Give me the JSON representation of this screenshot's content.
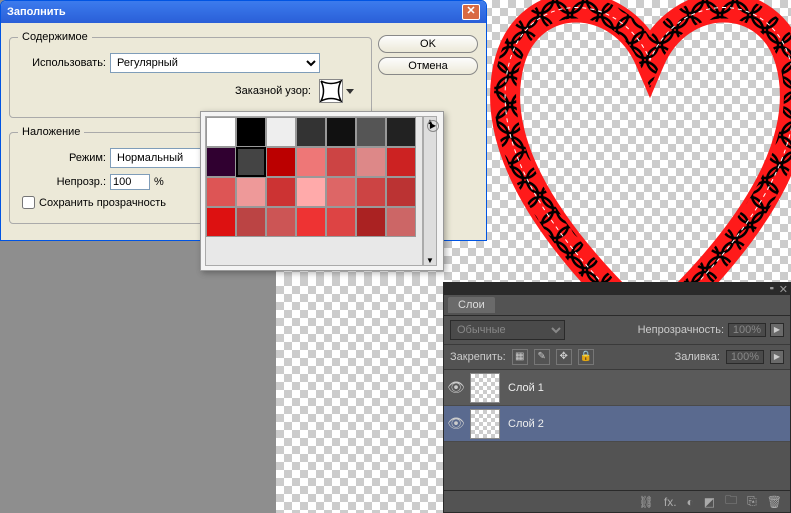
{
  "dialog": {
    "title": "Заполнить",
    "ok": "OK",
    "cancel": "Отмена",
    "content_legend": "Содержимое",
    "use_label": "Использовать:",
    "use_value": "Регулярный",
    "custom_pattern_label": "Заказной узор:",
    "overlay_legend": "Наложение",
    "mode_label": "Режим:",
    "mode_value": "Нормальный",
    "opacity_label": "Непрозр.:",
    "opacity_value": "100",
    "opacity_unit": "%",
    "preserve_label": "Сохранить прозрачность"
  },
  "layers": {
    "tab": "Слои",
    "blend": "Обычные",
    "opacity_label": "Непрозрачность:",
    "opacity_value": "100%",
    "lock_label": "Закрепить:",
    "fill_label": "Заливка:",
    "fill_value": "100%",
    "items": [
      {
        "name": "Слой 1"
      },
      {
        "name": "Слой 2"
      }
    ],
    "footer_icons": {
      "link": "⛓",
      "fx": "fx.",
      "mask": "◐",
      "adjust": "◩",
      "folder": "🗀",
      "new": "⎘",
      "trash": "🗑"
    }
  },
  "pattern_colors": [
    "#fff",
    "#000",
    "#eee",
    "#333",
    "#111",
    "#555",
    "#222",
    "#300030",
    "#444",
    "#b00",
    "#e77",
    "#c44",
    "#d88",
    "#c22",
    "#d55",
    "#e99",
    "#c33",
    "#faa",
    "#d66",
    "#c44",
    "#b33",
    "#d11",
    "#b44",
    "#c55",
    "#e33",
    "#d44",
    "#a22",
    "#c66"
  ]
}
